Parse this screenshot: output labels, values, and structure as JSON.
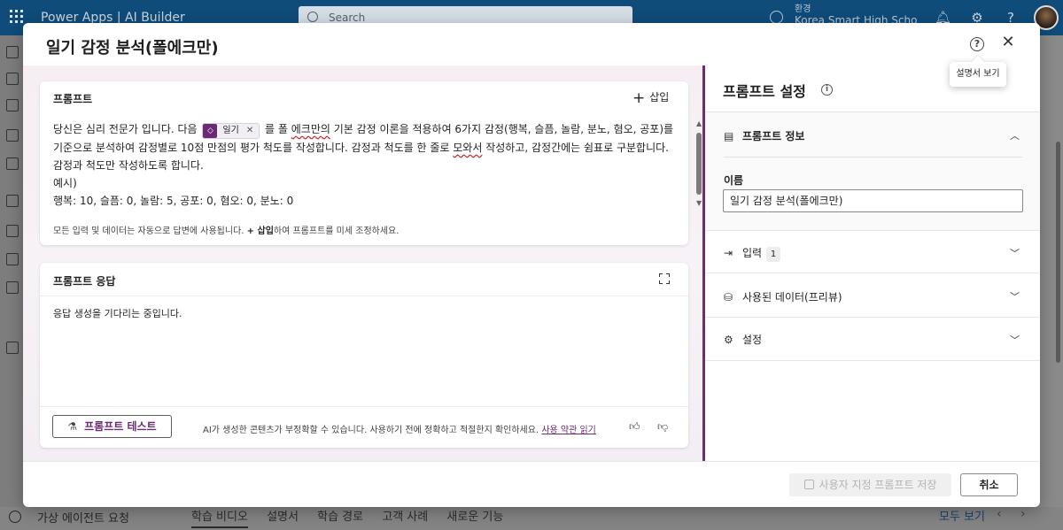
{
  "app": {
    "brand": "Power Apps  |  AI Builder",
    "search_placeholder": "Search",
    "env_label": "환경",
    "env_name": "Korea Smart High Scho"
  },
  "background": {
    "agent_request": "가상 에이전트 요청",
    "tabs": [
      "학습 비디오",
      "설명서",
      "학습 경로",
      "고객 사례",
      "새로운 기능"
    ],
    "see_all": "모두 보기"
  },
  "dialog": {
    "title": "일기 감정 분석(폴에크만)",
    "help_tooltip": "설명서 보기"
  },
  "prompt": {
    "header": "프롬프트",
    "insert_label": "삽입",
    "chip_label": "일기",
    "lines": {
      "l1_pre": "당신은 심리 전문가 입니다. 다음 ",
      "l1_post_a": " 를 폴 ",
      "l1_wavy": "에크만의",
      "l1_post_b": " 기본 감정 이론을 적용하여 6가지 감정(행복, 슬픔, 놀람, 분노, 혐오, 공포)를",
      "l2_a": "기준으로 분석하여 감정별로 10점 만점의 평가 척도를 작성합니다. 감정과 척도를 한 줄로 ",
      "l2_wavy": "모와서",
      "l2_b": " 작성하고, 감정간에는 쉼표로 구분합니다.",
      "l3": "감정과 척도만 작성하도록 합니다.",
      "l4": "예시)",
      "l5": "행복: 10, 슬픔: 0, 놀람: 5, 공포: 0, 혐오: 0, 분노: 0"
    },
    "hint_pre": "모든 입력 및 데이터는 자동으로 답변에 사용됩니다. ",
    "hint_bold": "+ 삽입",
    "hint_post": "하여 프롬프트를 미세 조정하세요."
  },
  "response": {
    "header": "프롬프트 응답",
    "waiting_text": "응답 생성을 기다리는 중입니다.",
    "test_button": "프롬프트 테스트",
    "disclaimer": "AI가 생성한 콘텐츠가 부정확할 수 있습니다. 사용하기 전에 정확하고 적절한지 확인하세요. ",
    "terms_link": "사용 약관 읽기"
  },
  "settings_panel": {
    "title": "프롬프트 설정",
    "info_section": "프롬프트 정보",
    "name_label": "이름",
    "name_value": "일기 감정 분석(폴에크만)",
    "input_section": "입력",
    "input_count": "1",
    "data_section": "사용된 데이터(프리뷰)",
    "settings_section": "설정"
  },
  "footer": {
    "save_button": "사용자 지정 프롬프트 저장",
    "cancel_button": "취소"
  }
}
